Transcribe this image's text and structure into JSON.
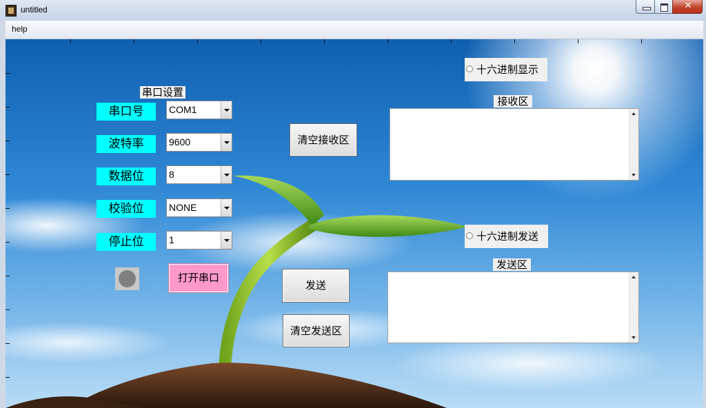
{
  "window": {
    "title": "untitled"
  },
  "menu": {
    "help": "help"
  },
  "serial_settings": {
    "title": "串口设置",
    "port_label": "串口号",
    "port_value": "COM1",
    "baud_label": "波特率",
    "baud_value": "9600",
    "databits_label": "数据位",
    "databits_value": "8",
    "parity_label": "校验位",
    "parity_value": "NONE",
    "stopbits_label": "停止位",
    "stopbits_value": "1",
    "open_button": "打开串口"
  },
  "buttons": {
    "clear_receive": "清空接收区",
    "send": "发送",
    "clear_send": "清空发送区"
  },
  "receive": {
    "hex_display": "十六进制显示",
    "title": "接收区"
  },
  "send_area": {
    "hex_send": "十六进制发送",
    "title": "发送区"
  },
  "colors": {
    "label_bg": "#00ffff",
    "open_btn_bg": "#ff99cc",
    "indicator": "#808080"
  }
}
